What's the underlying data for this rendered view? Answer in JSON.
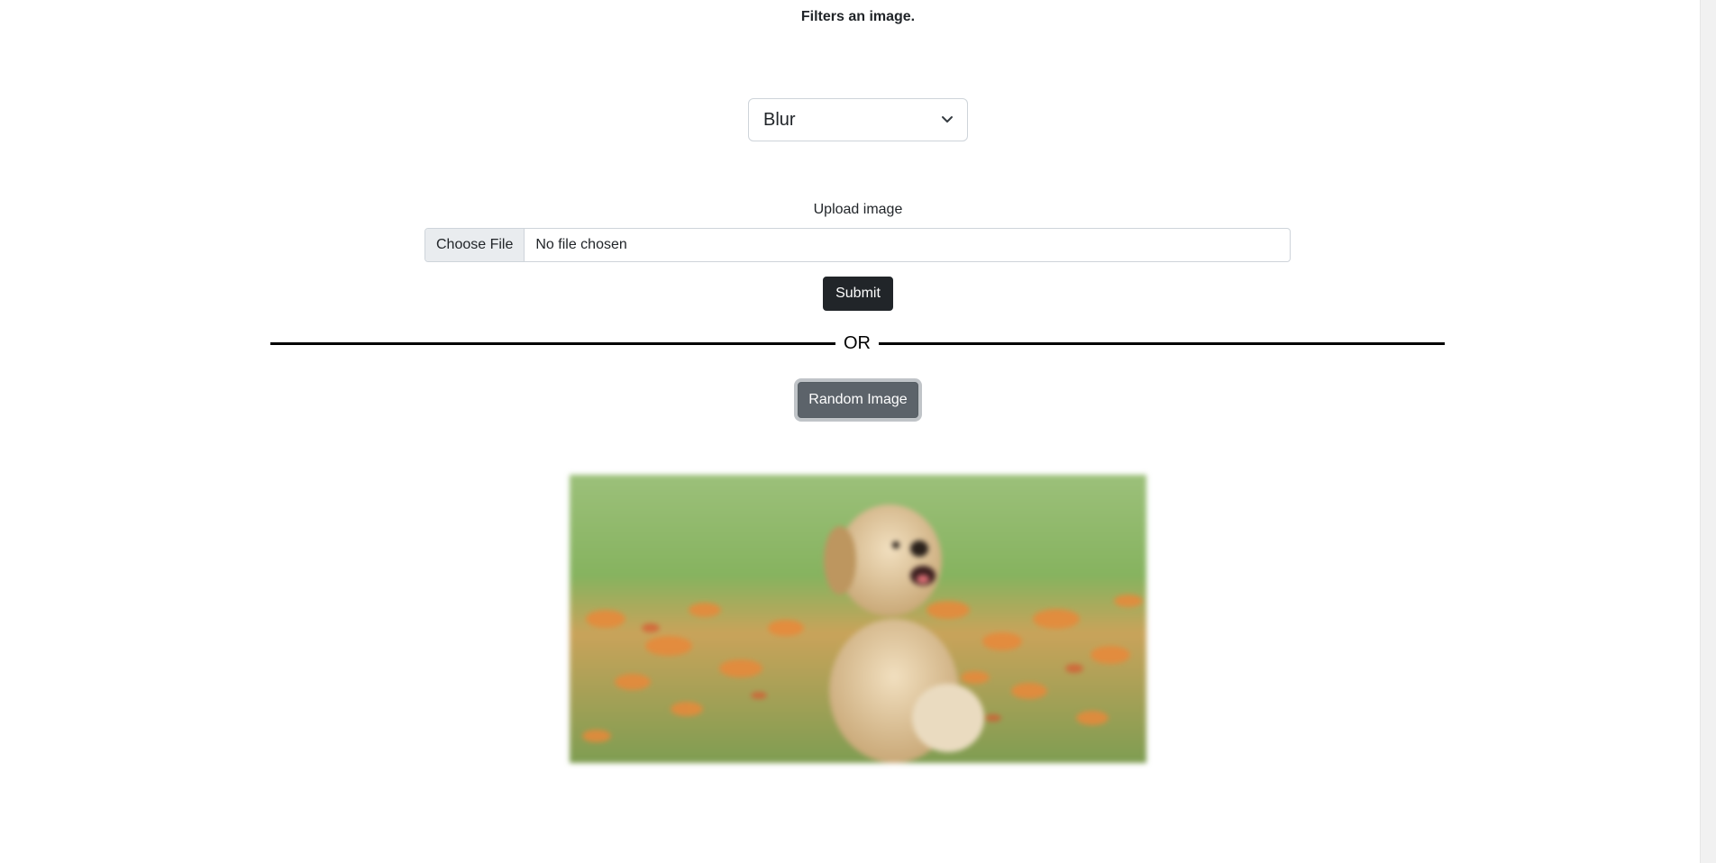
{
  "header": {
    "subtitle": "Filters an image."
  },
  "filter_select": {
    "selected": "Blur",
    "icon": "chevron-down-icon"
  },
  "upload": {
    "label": "Upload image",
    "button_label": "Choose File",
    "status": "No file chosen"
  },
  "actions": {
    "submit_label": "Submit",
    "divider_text": "OR",
    "random_label": "Random Image"
  },
  "result_image": {
    "subject": "blurred-puppy-photo"
  },
  "colors": {
    "submit_bg": "#212529",
    "random_bg": "#5c636a",
    "divider": "#000000"
  }
}
